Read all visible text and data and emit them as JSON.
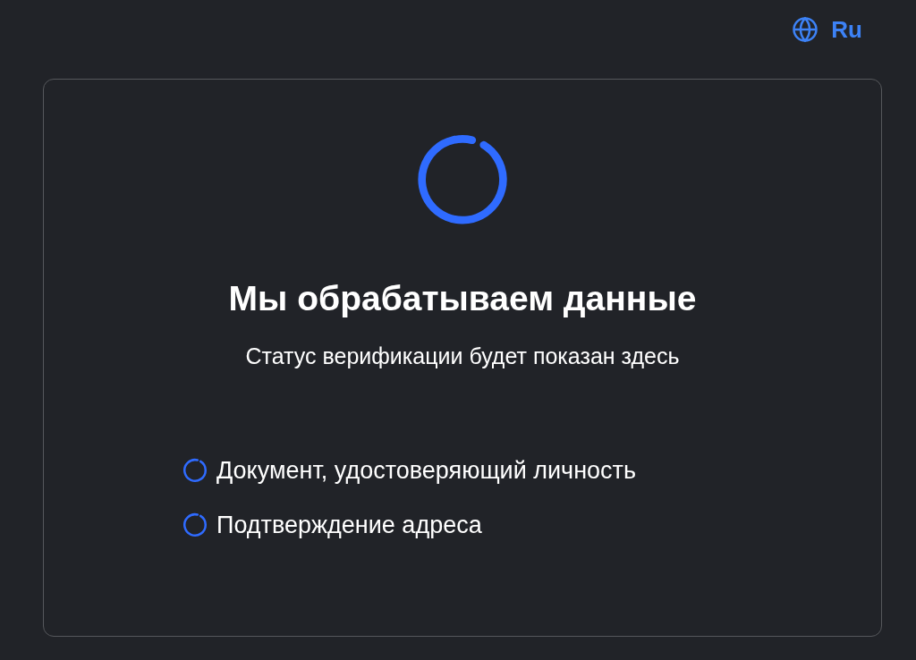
{
  "language": {
    "label": "Ru"
  },
  "card": {
    "title": "Мы обрабатываем данные",
    "subtitle": "Статус верификации будет показан здесь",
    "checks": [
      {
        "label": "Документ, удостоверяющий личность",
        "loading": true
      },
      {
        "label": "Подтверждение адреса",
        "loading": true
      }
    ]
  }
}
